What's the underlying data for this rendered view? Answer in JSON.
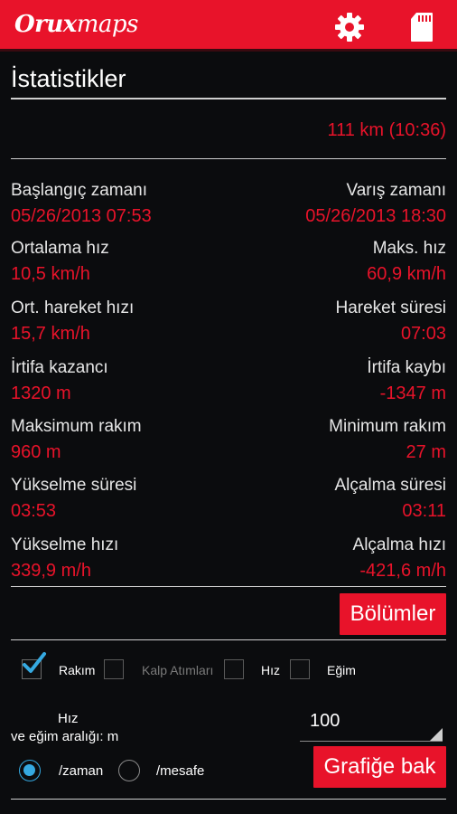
{
  "app": {
    "logo_part1": "Orux",
    "logo_part2": "maps"
  },
  "page_title": "İstatistikler",
  "total": "111 km (10:36)",
  "stats": [
    {
      "left_label": "Başlangıç zamanı",
      "left_value": "05/26/2013 07:53",
      "right_label": "Varış zamanı",
      "right_value": "05/26/2013 18:30"
    },
    {
      "left_label": "Ortalama hız",
      "left_value": "10,5 km/h",
      "right_label": "Maks. hız",
      "right_value": "60,9 km/h"
    },
    {
      "left_label": "Ort. hareket hızı",
      "left_value": "15,7 km/h",
      "right_label": "Hareket süresi",
      "right_value": "07:03"
    },
    {
      "left_label": "İrtifa kazancı",
      "left_value": "1320 m",
      "right_label": "İrtifa kaybı",
      "right_value": "-1347 m"
    },
    {
      "left_label": "Maksimum rakım",
      "left_value": "960 m",
      "right_label": "Minimum rakım",
      "right_value": "27 m"
    },
    {
      "left_label": "Yükselme süresi",
      "left_value": "03:53",
      "right_label": "Alçalma süresi",
      "right_value": "03:11"
    },
    {
      "left_label": "Yükselme hızı",
      "left_value": "339,9 m/h",
      "right_label": "Alçalma hızı",
      "right_value": "-421,6 m/h"
    }
  ],
  "segments_button": "Bölümler",
  "checkboxes": [
    {
      "label": "Rakım",
      "checked": true
    },
    {
      "label": "Kalp Atımları",
      "checked": false
    },
    {
      "label": "Hız",
      "checked": false
    },
    {
      "label": "Eğim",
      "checked": false
    }
  ],
  "interval": {
    "label_line1": "Hız",
    "label_line2": "ve eğim aralığı: m",
    "value": "100"
  },
  "radios": [
    {
      "label": "/zaman",
      "selected": true
    },
    {
      "label": "/mesafe",
      "selected": false
    }
  ],
  "graph_button": "Grafiğe bak",
  "colors": {
    "accent": "#e8132a",
    "check": "#35a9e1"
  }
}
